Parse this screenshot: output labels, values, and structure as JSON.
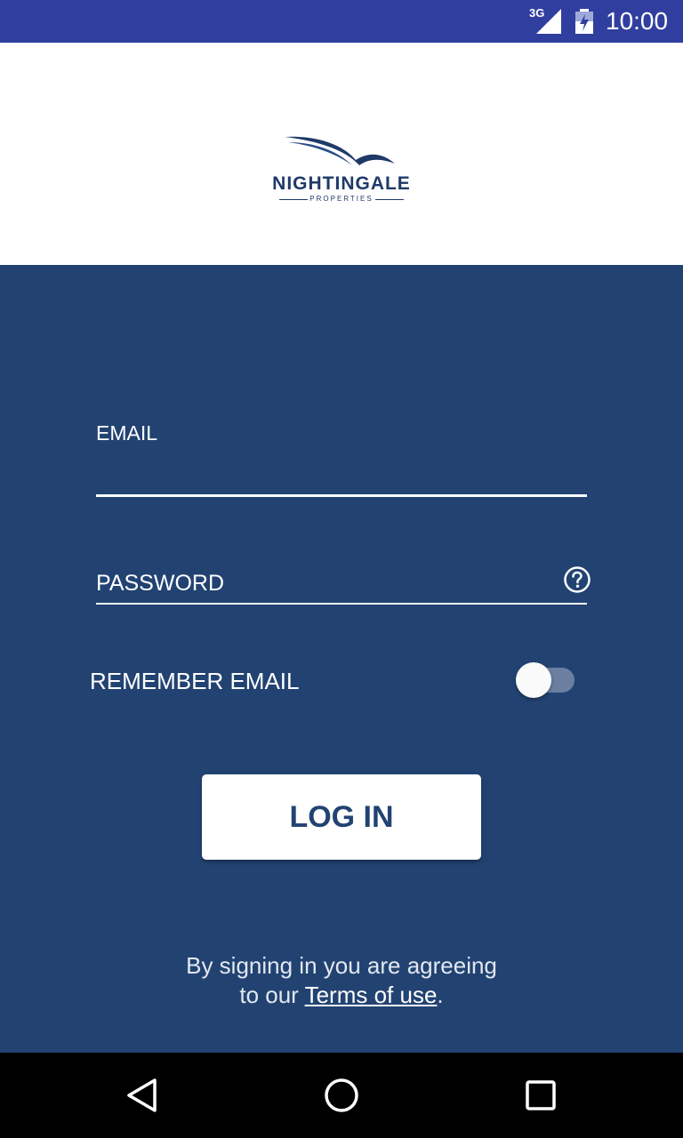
{
  "status_bar": {
    "network_type": "3G",
    "time": "10:00",
    "icons": [
      "signal-icon",
      "battery-icon"
    ],
    "background": "#303f9f"
  },
  "header": {
    "logo": {
      "name": "NIGHTINGALE",
      "subtitle": "PROPERTIES",
      "icon": "bird-swoosh-logo"
    },
    "background": "#ffffff"
  },
  "form": {
    "email_label": "EMAIL",
    "email_value": "",
    "password_label": "PASSWORD",
    "password_help_icon": "help-circle-icon",
    "remember_label": "REMEMBER EMAIL",
    "remember_on": false,
    "login_label": "LOG IN"
  },
  "terms": {
    "line1": "By signing in you are agreeing",
    "line2_prefix": "to our ",
    "link": "Terms of use",
    "line2_suffix": "."
  },
  "nav_bar": {
    "icons": [
      "back-icon",
      "home-icon",
      "recents-icon"
    ]
  },
  "colors": {
    "primary": "#224372",
    "on_primary": "#ffffff",
    "toggle_track": "#6b7fa1",
    "nav_bar": "#000000"
  }
}
